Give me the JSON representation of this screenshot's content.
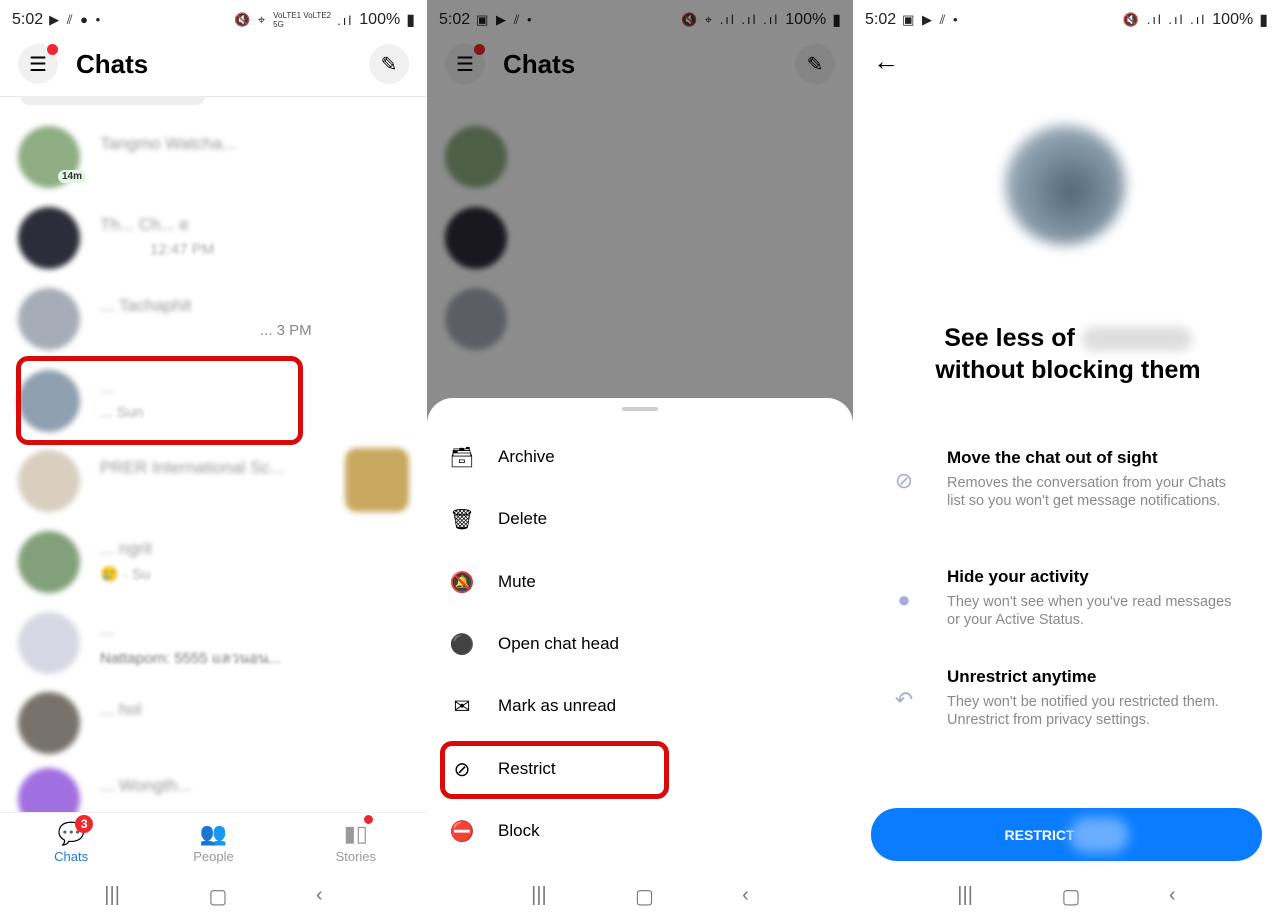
{
  "status": {
    "time": "5:02",
    "battery": "100%",
    "signal": "VoLTE1 VoLTE2 5G"
  },
  "panel1": {
    "title": "Chats",
    "chats": [
      {
        "name": "Tangmo Watcha...",
        "meta": "",
        "badge": "14m"
      },
      {
        "name": "Th... Ch... e",
        "meta": "12:47 PM"
      },
      {
        "name": "... Tachaphit",
        "meta": "... 3 PM"
      },
      {
        "name": "...",
        "meta": "... Sun"
      },
      {
        "name": "PRER International Sc...",
        "meta": ""
      },
      {
        "name": "... ngrit",
        "meta": "🥲 · Su"
      },
      {
        "name": "...",
        "meta": "Nattaporn: 5555 แลวนอน..."
      },
      {
        "name": "... hol",
        "meta": ""
      },
      {
        "name": "... Wongth...",
        "meta": ""
      }
    ],
    "nav": [
      {
        "label": "Chats",
        "count": "3"
      },
      {
        "label": "People"
      },
      {
        "label": "Stories"
      }
    ]
  },
  "panel2": {
    "title": "Chats",
    "menu": [
      {
        "label": "Archive",
        "icon": "archive-icon"
      },
      {
        "label": "Delete",
        "icon": "trash-icon"
      },
      {
        "label": "Mute",
        "icon": "bell-off-icon"
      },
      {
        "label": "Open chat head",
        "icon": "chat-head-icon"
      },
      {
        "label": "Mark as unread",
        "icon": "mail-unread-icon"
      },
      {
        "label": "Restrict",
        "icon": "restrict-icon"
      },
      {
        "label": "Block",
        "icon": "block-icon"
      }
    ]
  },
  "panel3": {
    "title_pre": "See less of",
    "title_post": "without blocking them",
    "features": [
      {
        "title": "Move the chat out of sight",
        "desc": "Removes the conversation from your Chats list so you won't get message notifications."
      },
      {
        "title": "Hide your activity",
        "desc": "They won't see when you've read messages or your Active Status."
      },
      {
        "title": "Unrestrict anytime",
        "desc": "They won't be notified you restricted them. Unrestrict from privacy settings."
      }
    ],
    "button": "RESTRICT"
  },
  "colors": {
    "accent": "#0a7cff",
    "highlight": "#d90a0a",
    "badge": "#f0282d"
  }
}
